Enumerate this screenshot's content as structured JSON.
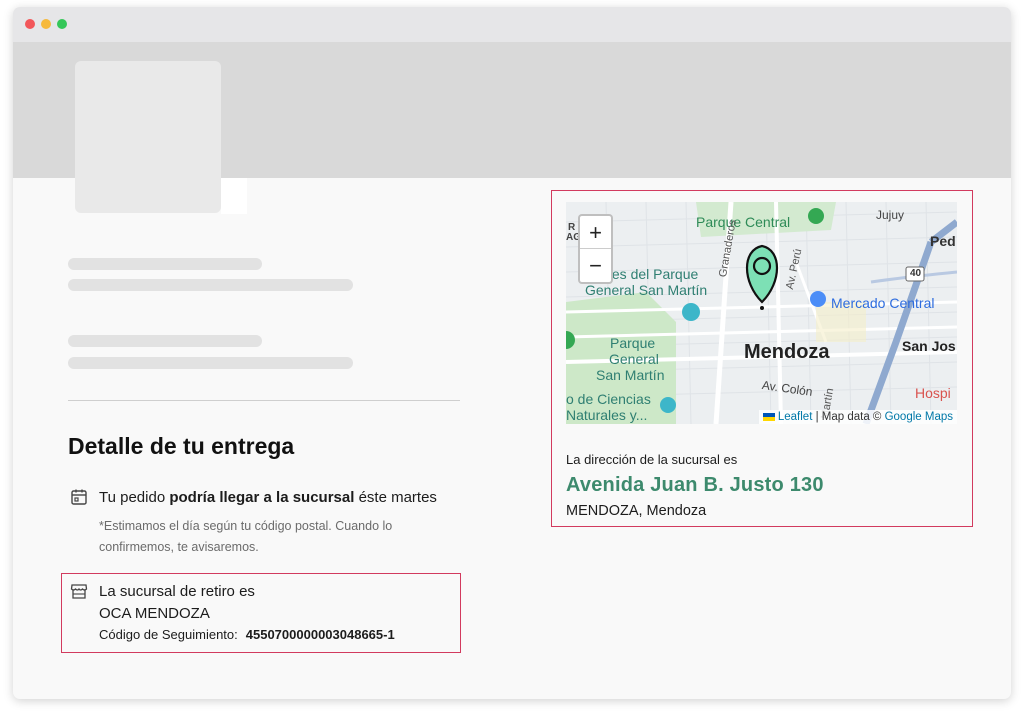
{
  "window": {
    "controls": [
      "close",
      "minimize",
      "maximize"
    ]
  },
  "delivery": {
    "section_title": "Detalle de tu entrega",
    "eta": {
      "prefix": "Tu pedido ",
      "emphasis": "podría llegar a la sucursal",
      "suffix": " éste martes",
      "note": "*Estimamos el día según tu código postal. Cuando lo confirmemos, te avisaremos."
    },
    "branch": {
      "label": "La sucursal de retiro es",
      "name": "OCA MENDOZA",
      "tracking_label": "Código de Seguimiento:",
      "tracking_code": "4550700000003048665-1"
    }
  },
  "map": {
    "zoom_in": "+",
    "zoom_out": "−",
    "labels": {
      "parque_central": "Parque Central",
      "jujuy": "Jujuy",
      "ped": "Ped",
      "ines_parque": "ines del Parque",
      "general_san_martin": "General San Martín",
      "granaderos": "Granaderos",
      "av_peru": "Av. Perú",
      "mercado_central": "Mercado Central",
      "parque": "Parque",
      "general": "General",
      "san_martin": "San Martín",
      "mendoza": "Mendoza",
      "san_jos": "San Jos",
      "av_colon": "Av. Colón",
      "martin": "Martín",
      "o_de_ciencias": "o de Ciencias",
      "naturales": "Naturales y...",
      "hospi": "Hospi",
      "route_40": "40",
      "edge_r": "R",
      "edge_ag": "AG"
    },
    "attribution": {
      "leaflet": "Leaflet",
      "separator": " | Map data © ",
      "google": "Google Maps"
    },
    "colors": {
      "marker": "#7de0b5",
      "park": "#c8e6c4",
      "road": "#9bb5d6"
    }
  },
  "address": {
    "label": "La dirección de la sucursal es",
    "street": "Avenida Juan B. Justo 130",
    "city": "MENDOZA, Mendoza"
  }
}
